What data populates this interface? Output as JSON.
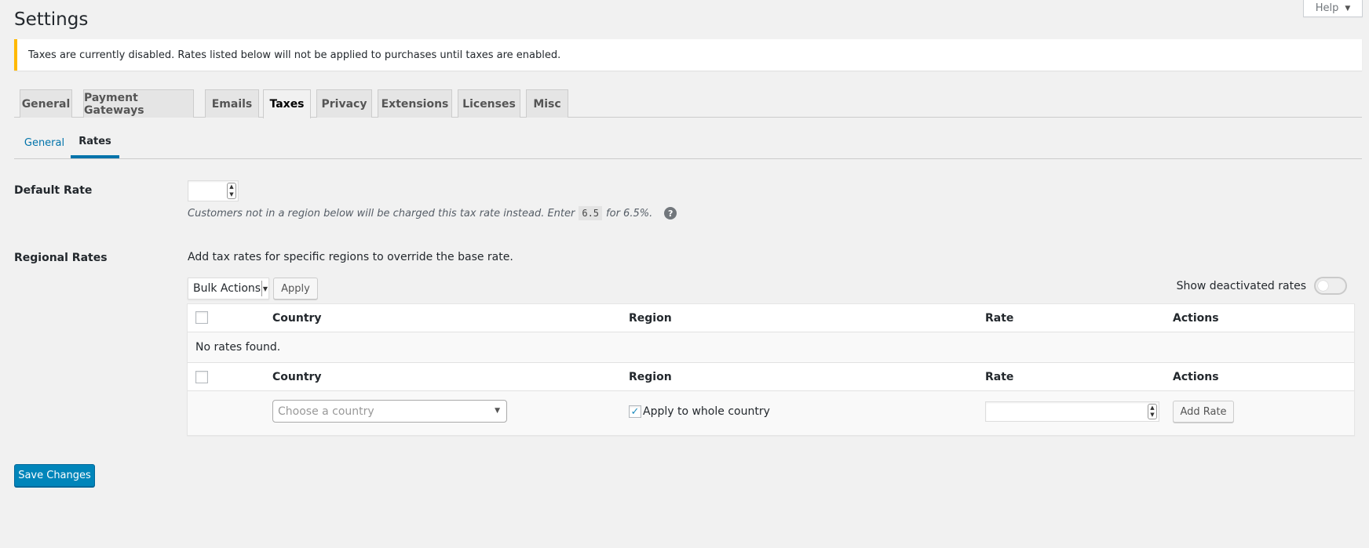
{
  "page": {
    "title": "Settings",
    "help_label": "Help"
  },
  "notice": {
    "text": "Taxes are currently disabled. Rates listed below will not be applied to purchases until taxes are enabled."
  },
  "tabs": [
    {
      "label": "General"
    },
    {
      "label": "Payment Gateways"
    },
    {
      "label": "Emails"
    },
    {
      "label": "Taxes",
      "active": true
    },
    {
      "label": "Privacy"
    },
    {
      "label": "Extensions"
    },
    {
      "label": "Licenses"
    },
    {
      "label": "Misc"
    }
  ],
  "subtabs": [
    {
      "label": "General"
    },
    {
      "label": "Rates",
      "current": true
    }
  ],
  "default_rate": {
    "label": "Default Rate",
    "value": "",
    "description_before": "Customers not in a region below will be charged this tax rate instead. Enter",
    "example_code": "6.5",
    "description_after": "for 6.5%."
  },
  "regional_rates": {
    "label": "Regional Rates",
    "description": "Add tax rates for specific regions to override the base rate.",
    "bulk_actions_label": "Bulk Actions",
    "apply_label": "Apply",
    "show_deactivated_label": "Show deactivated rates",
    "show_deactivated_on": false,
    "columns": {
      "country": "Country",
      "region": "Region",
      "rate": "Rate",
      "actions": "Actions"
    },
    "empty_message": "No rates found.",
    "country_placeholder": "Choose a country",
    "apply_whole_country_label": "Apply to whole country",
    "apply_whole_country_checked": true,
    "add_rate_label": "Add Rate"
  },
  "footer": {
    "save_label": "Save Changes"
  },
  "colors": {
    "primary": "#0085ba",
    "link": "#0073aa",
    "notice_warning": "#ffb900"
  }
}
